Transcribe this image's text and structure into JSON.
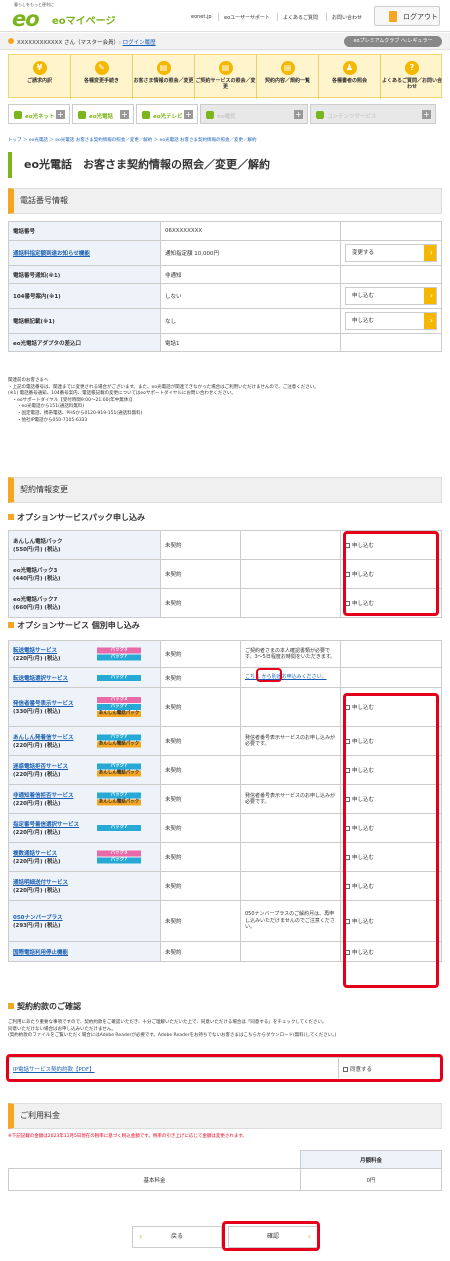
{
  "header": {
    "tagline": "暮らしをもっと便利に",
    "logo_eo": "eo",
    "logo_my": "eoマイページ",
    "nav": [
      "eonet.jp",
      "eoユーザーサポート",
      "よくあるご質問",
      "お問い合わせ"
    ],
    "logout": "ログアウト"
  },
  "userbar": {
    "account": "XXXXXXXXXXXX さん（マスター会員）:",
    "login_history": "ログイン履歴",
    "club": "eoプレミアムクラブ へ:レギュラー"
  },
  "menu": [
    {
      "icon": "¥",
      "label": "ご請求内訳"
    },
    {
      "icon": "✎",
      "label": "各種変更手続き"
    },
    {
      "icon": "▤",
      "label": "お客さま情報の照会／変更"
    },
    {
      "icon": "▤",
      "label": "ご契約サービスの照会／変更"
    },
    {
      "icon": "▤",
      "label": "契約内容／規約一覧"
    },
    {
      "icon": "♟",
      "label": "各種書者の照会"
    },
    {
      "icon": "?",
      "label": "よくあるご質問／お問い合わせ"
    }
  ],
  "services": [
    "eo光ネット",
    "eo光電話",
    "eo光テレビ",
    "eo電気",
    "コンテンツサービス"
  ],
  "breadcrumb": "トップ ＞ eo光電話 ＞ eo光電話 お客さま契約情報の照会／変更／解約 ＞ eo光電話 お客さま契約情報の照会／変更／解約",
  "page_title": "eo光電話　お客さま契約情報の照会／変更／解約",
  "phone_section": {
    "title": "電話番号情報",
    "rows": [
      {
        "label": "電話番号",
        "value": "06XXXXXXXX",
        "link": false,
        "action": ""
      },
      {
        "label": "通話料指定額到達お知らせ機能",
        "value": "通知指定額 10,000円",
        "link": true,
        "action": "変更する"
      },
      {
        "label": "電話番号通知(※1)",
        "value": "非通知",
        "link": false,
        "action": ""
      },
      {
        "label": "104番号案内(※1)",
        "value": "しない",
        "link": false,
        "action": "申し込む"
      },
      {
        "label": "電話帳記載(※1)",
        "value": "なし",
        "link": false,
        "action": "申し込む"
      },
      {
        "label": "eo光電話アダプタの差込口",
        "value": "電話1",
        "link": false,
        "action": ""
      }
    ]
  },
  "notes1": [
    "関連前のお客さまへ",
    "・上記の電話番号は、関連までに変更される場合がございます。また、eo光電話が関連できなかった場合はご利用いただけませんので、ご注意ください。",
    "(※1) 電話番号通知、104番号案内、電話帳記載の変更についてはeoサポートダイヤルにお問い合わせください。",
    "　・eoサポートダイヤル【受付時間9:00〜21:00(年中無休)】",
    "　　・eo光電話から151(通話料無料)",
    "　　・固定電話、携帯電話、PHSから0120-919-151(通話料無料)",
    "　　・他社IP電話から050-7105-6333"
  ],
  "contract_section": {
    "title": "契約情報変更"
  },
  "pack_heading": "オプションサービスパック申し込み",
  "packs": [
    {
      "name": "あんしん電話パック",
      "price": "(550円/月) (税込)",
      "status": "未契約",
      "apply": "申し込む"
    },
    {
      "name": "eo光電話パック3",
      "price": "(440円/月) (税込)",
      "status": "未契約",
      "apply": "申し込む"
    },
    {
      "name": "eo光電話パック7",
      "price": "(660円/月) (税込)",
      "status": "未契約",
      "apply": "申し込む"
    }
  ],
  "indiv_heading": "オプションサービス 個別申し込み",
  "options": [
    {
      "name": "転送電話サービス",
      "price": "(220円/月) (税込)",
      "badges": [
        "パック3",
        "パック7"
      ],
      "status": "未契約",
      "note": "ご契約者さまの本人確認書類が必要です。3〜5日程度お時間をいただきます。",
      "apply": ""
    },
    {
      "name": "転送電話選択サービス",
      "price": "",
      "badges": [
        "パック7"
      ],
      "status": "未契約",
      "note": "こちら から別途お申込みください。",
      "apply": ""
    },
    {
      "name": "発信者番号表示サービス",
      "price": "(330円/月) (税込)",
      "badges": [
        "パック3",
        "パック7",
        "あんしん電話パック"
      ],
      "status": "未契約",
      "note": "",
      "apply": "申し込む"
    },
    {
      "name": "あんしん発着信サービス",
      "price": "(220円/月) (税込)",
      "badges": [
        "パック7",
        "あんしん電話パック"
      ],
      "status": "未契約",
      "note": "発信者番号表示サービスのお申し込みが必要です。",
      "apply": "申し込む"
    },
    {
      "name": "迷惑電話拒否サービス",
      "price": "(220円/月) (税込)",
      "badges": [
        "パック7",
        "あんしん電話パック"
      ],
      "status": "未契約",
      "note": "",
      "apply": "申し込む"
    },
    {
      "name": "非通知着信拒否サービス",
      "price": "(220円/月) (税込)",
      "badges": [
        "パック7",
        "あんしん電話パック"
      ],
      "status": "未契約",
      "note": "発信者番号表示サービスのお申し込みが必要です。",
      "apply": "申し込む"
    },
    {
      "name": "指定番号着信選択サービス",
      "price": "(220円/月) (税込)",
      "badges": [
        "パック7"
      ],
      "status": "未契約",
      "note": "",
      "apply": "申し込む"
    },
    {
      "name": "複数通話サービス",
      "price": "(220円/月) (税込)",
      "badges": [
        "パック3",
        "パック7"
      ],
      "status": "未契約",
      "note": "",
      "apply": "申し込む"
    },
    {
      "name": "通話明細送付サービス",
      "price": "(220円/月) (税込)",
      "badges": [],
      "status": "未契約",
      "note": "",
      "apply": "申し込む"
    },
    {
      "name": "050ナンバープラス",
      "price": "(293円/月) (税込)",
      "badges": [],
      "status": "未契約",
      "note": "050ナンバープラスのご解約月は、再申し込みいただけませんのでご注意ください。",
      "apply": "申し込む"
    },
    {
      "name": "国際電話利用停止機能",
      "price": "",
      "badges": [],
      "status": "未契約",
      "note": "",
      "apply": "申し込む"
    }
  ],
  "terms": {
    "heading": "契約約款のご確認",
    "text": [
      "ご利用にあたり重要な事項ですので、契約約款をご確認いただき、十分ご理解いただいた上で、同意いただける場合は「同意する」をチェックしてください。",
      "同意いただけない場合はお申し込みいただけません。",
      "(契約約款のファイルをご覧いただく場合にはAdobe Readerが必要です。Adobe Readerをお持ちでないお客さまはこちらからダウンロード(無料)してください。)"
    ],
    "link": "IP電話サービス契約約款【PDF】",
    "agree": "同意する"
  },
  "fee": {
    "title": "ご利用料金",
    "note": "※下記記載の金額は2023年11月5日現在の税率に基づく税込金額です。税率の引き上げに応じて金額は変更されます。",
    "col": "月額料金",
    "label": "基本料金",
    "value": "0円"
  },
  "nav": {
    "back": "戻る",
    "confirm": "確認"
  }
}
